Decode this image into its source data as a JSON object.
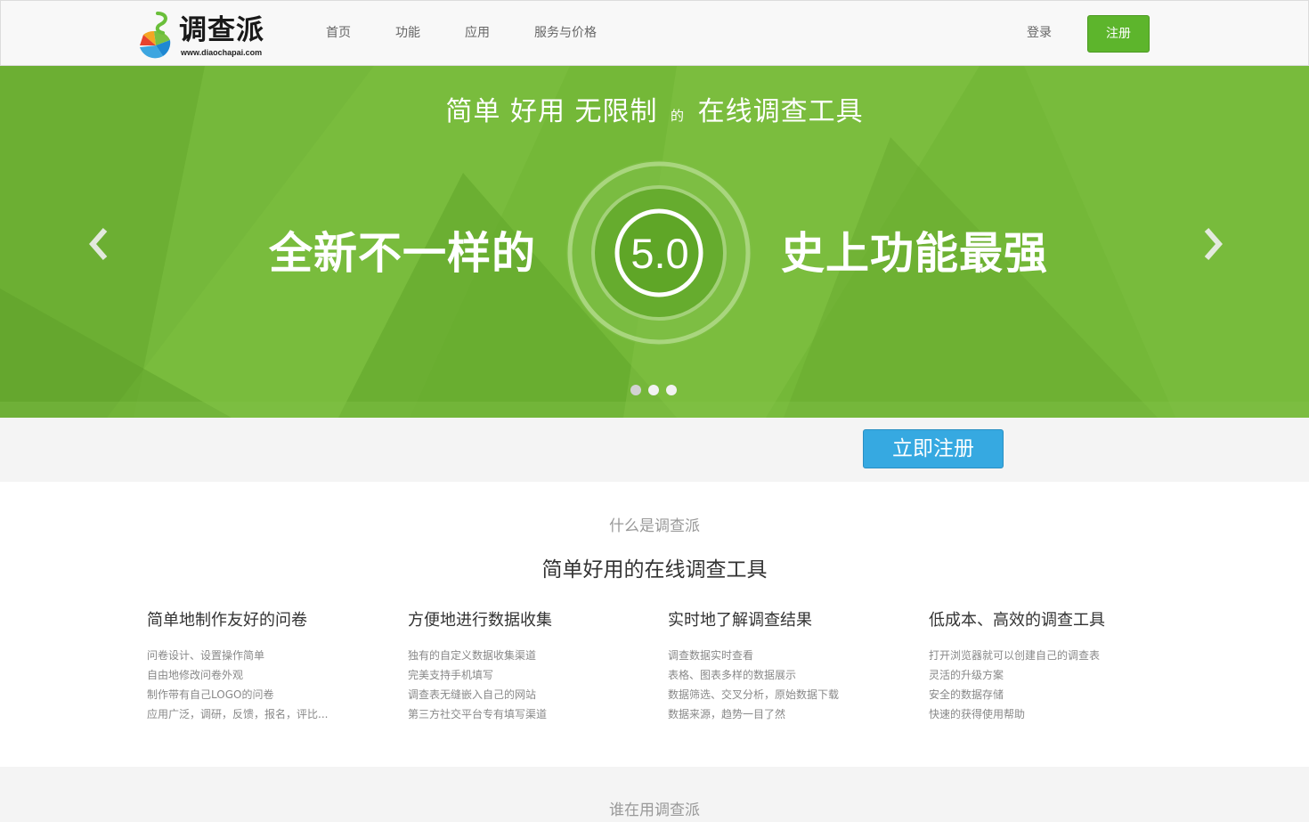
{
  "header": {
    "logo_name": "调查派",
    "logo_url": "www.diaochapai.com",
    "nav": [
      "首页",
      "功能",
      "应用",
      "服务与价格"
    ],
    "login": "登录",
    "register": "注册"
  },
  "banner": {
    "tagline_a": "简单 好用 无限制",
    "tagline_small": "的",
    "tagline_b": "在线调查工具",
    "left_text": "全新不一样的",
    "version": "5.0",
    "right_text": "史上功能最强",
    "active_slide": 0,
    "slide_count": 3
  },
  "cta": {
    "label": "立即注册"
  },
  "intro": {
    "eyebrow": "什么是调查派",
    "title": "简单好用的在线调查工具",
    "features": [
      {
        "title": "简单地制作友好的问卷",
        "lines": [
          "问卷设计、设置操作简单",
          "自由地修改问卷外观",
          "制作带有自己LOGO的问卷",
          "应用广泛，调研，反馈，报名，评比..."
        ]
      },
      {
        "title": "方便地进行数据收集",
        "lines": [
          "独有的自定义数据收集渠道",
          "完美支持手机填写",
          "调查表无缝嵌入自己的网站",
          "第三方社交平台专有填写渠道"
        ]
      },
      {
        "title": "实时地了解调查结果",
        "lines": [
          "调查数据实时查看",
          "表格、图表多样的数据展示",
          "数据筛选、交叉分析，原始数据下载",
          "数据来源，趋势一目了然"
        ]
      },
      {
        "title": "低成本、高效的调查工具",
        "lines": [
          "打开浏览器就可以创建自己的调查表",
          "灵活的升级方案",
          "安全的数据存储",
          "快速的获得使用帮助"
        ]
      }
    ]
  },
  "users": {
    "title": "谁在用调查派"
  },
  "colors": {
    "brand_green": "#74b838",
    "register_green": "#5db52c",
    "cta_blue": "#36a9e1"
  }
}
